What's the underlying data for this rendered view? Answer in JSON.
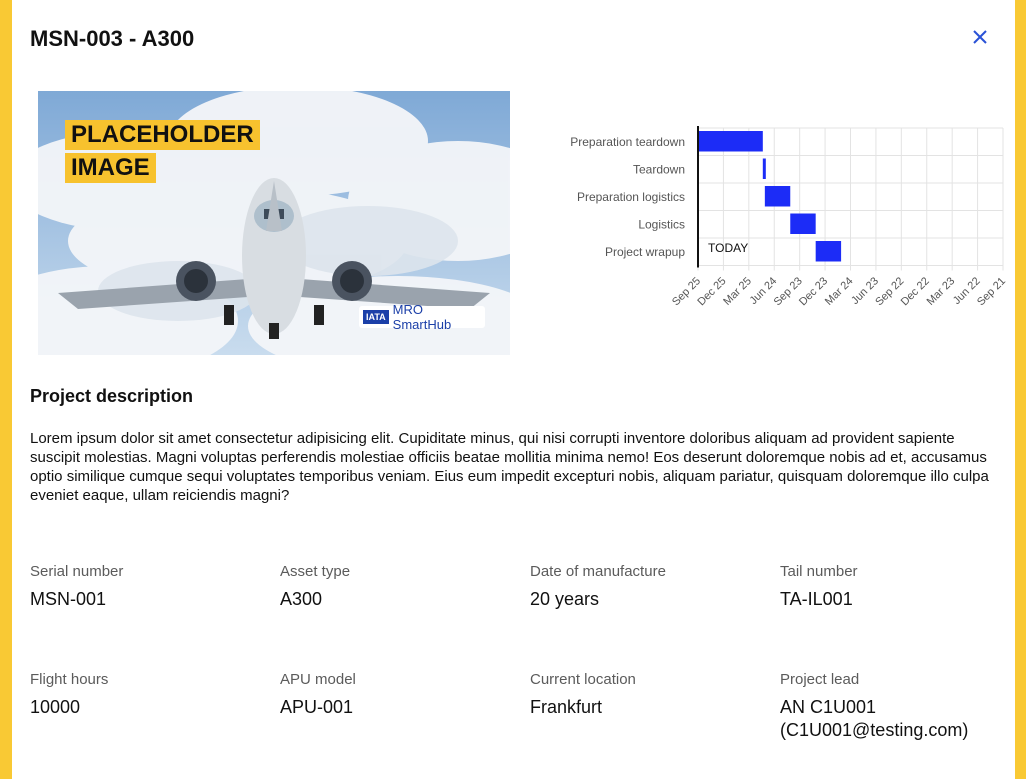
{
  "modal": {
    "title": "MSN-003 - A300",
    "close_icon": "close-icon"
  },
  "hero": {
    "placeholder_line1": "PLACEHOLDER",
    "placeholder_line2": "IMAGE",
    "badge_logo": "IATA",
    "badge_text": "MRO SmartHub"
  },
  "gantt": {
    "today_label": "TODAY",
    "bar_color": "#1c2cf7",
    "tasks": [
      "Preparation teardown",
      "Teardown",
      "Preparation logistics",
      "Logistics",
      "Project wrapup"
    ],
    "ticks": [
      "Sep 25",
      "Dec 25",
      "Mar 25",
      "Jun 24",
      "Sep 23",
      "Dec 23",
      "Mar 24",
      "Jun 23",
      "Sep 22",
      "Dec 22",
      "Mar 23",
      "Jun 22",
      "Sep 21"
    ]
  },
  "description": {
    "heading": "Project description",
    "text": "Lorem ipsum dolor sit amet consectetur adipisicing elit. Cupiditate minus, qui nisi corrupti inventore doloribus aliquam ad provident sapiente suscipit molestias. Magni voluptas perferendis molestiae officiis beatae mollitia minima nemo! Eos deserunt doloremque nobis ad et, accusamus optio similique cumque sequi voluptates temporibus veniam. Eius eum impedit excepturi nobis, aliquam pariatur, quisquam doloremque illo culpa eveniet eaque, ullam reiciendis magni?"
  },
  "details": {
    "serial_label": "Serial number",
    "serial_value": "MSN-001",
    "asset_label": "Asset type",
    "asset_value": "A300",
    "dom_label": "Date of manufacture",
    "dom_value": "20 years",
    "tail_label": "Tail number",
    "tail_value": "TA-IL001",
    "hours_label": "Flight hours",
    "hours_value": "10000",
    "apu_label": "APU model",
    "apu_value": "APU-001",
    "location_label": "Current location",
    "location_value": "Frankfurt",
    "lead_label": "Project lead",
    "lead_name": "AN C1U001",
    "lead_email": "(C1U001@testing.com)"
  }
}
